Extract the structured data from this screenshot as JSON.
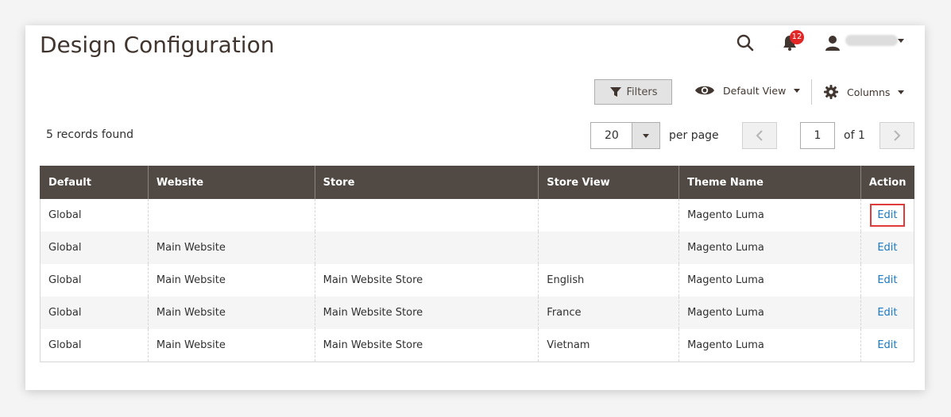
{
  "page": {
    "title": "Design Configuration"
  },
  "header": {
    "notification_count": "12"
  },
  "toolbar": {
    "filters_label": "Filters",
    "view_label": "Default View",
    "columns_label": "Columns"
  },
  "grid_info": {
    "records_found": "5 records found",
    "per_page_value": "20",
    "per_page_label": "per page",
    "current_page": "1",
    "of_pages": "of 1"
  },
  "table": {
    "headers": [
      "Default",
      "Website",
      "Store",
      "Store View",
      "Theme Name",
      "Action"
    ],
    "rows": [
      [
        "Global",
        "",
        "",
        "",
        "Magento Luma",
        "Edit"
      ],
      [
        "Global",
        "Main Website",
        "",
        "",
        "Magento Luma",
        "Edit"
      ],
      [
        "Global",
        "Main Website",
        "Main Website Store",
        "English",
        "Magento Luma",
        "Edit"
      ],
      [
        "Global",
        "Main Website",
        "Main Website Store",
        "France",
        "Magento Luma",
        "Edit"
      ],
      [
        "Global",
        "Main Website",
        "Main Website Store",
        "Vietnam",
        "Magento Luma",
        "Edit"
      ]
    ]
  },
  "colors": {
    "header_bg": "#514943",
    "link": "#1979c3",
    "highlight": "#e03b3b",
    "badge": "#e22626"
  },
  "icons": [
    "search-icon",
    "bell-icon",
    "user-icon",
    "filter-icon",
    "eye-icon",
    "gear-icon",
    "chevron-left-icon",
    "chevron-right-icon"
  ]
}
